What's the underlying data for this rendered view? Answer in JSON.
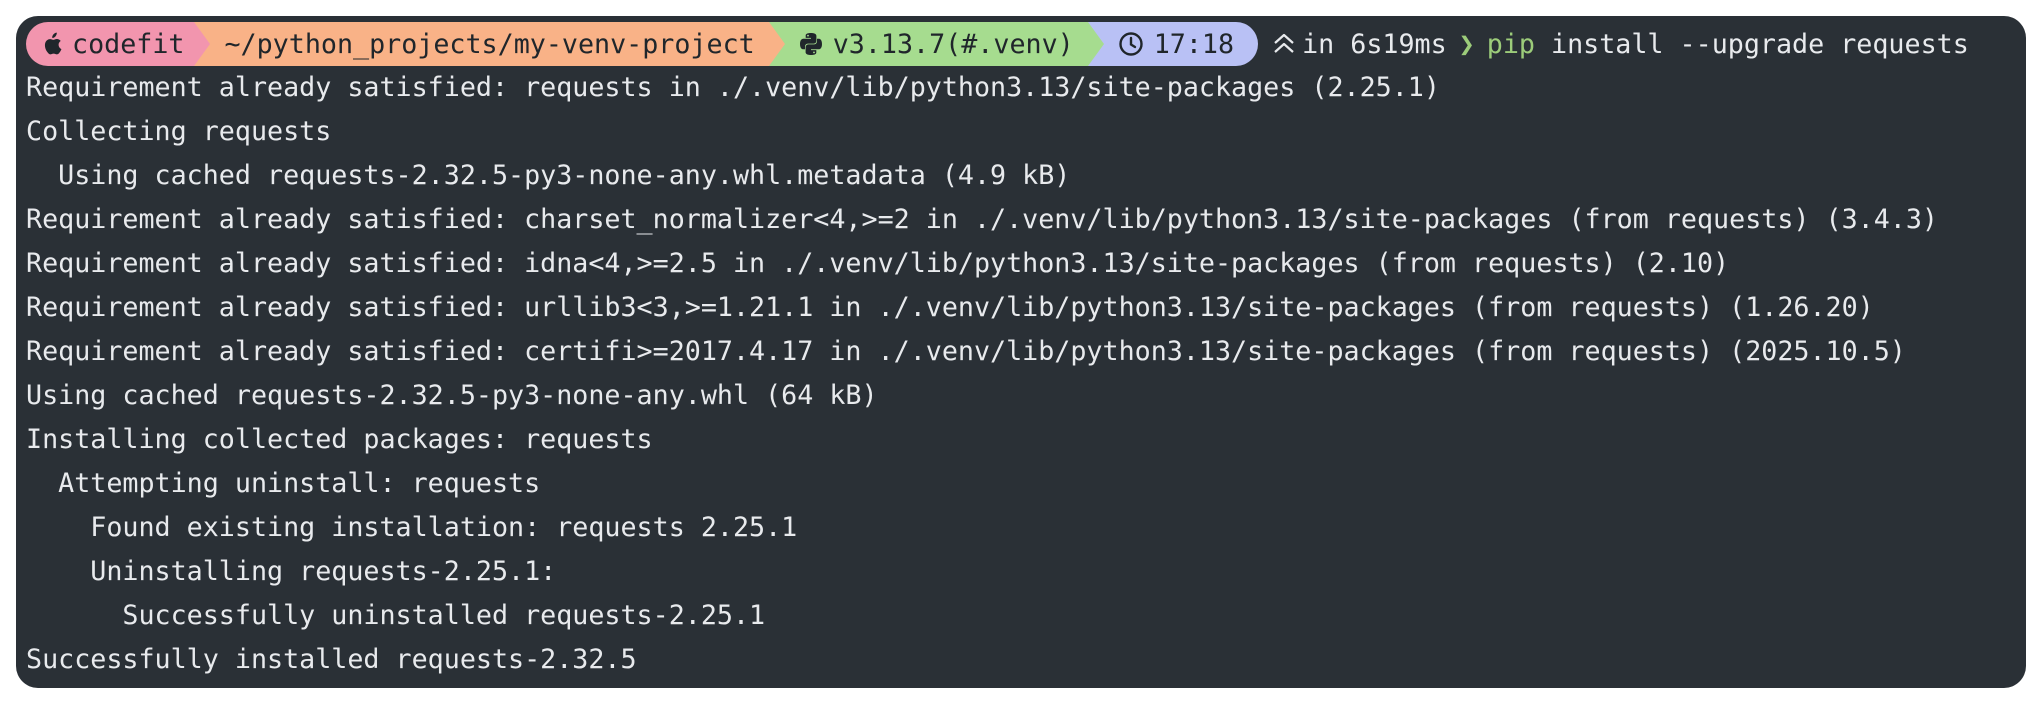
{
  "prompt": {
    "user": "codefit",
    "path": "~/python_projects/my-venv-project",
    "python": "v3.13.7(#.venv)",
    "time": "17:18",
    "duration": "in 6s19ms",
    "chevron": "❯",
    "command_head": "pip",
    "command_rest": " install --upgrade requests",
    "icons": {
      "os": "apple-icon",
      "python": "python-icon",
      "time": "clock-icon",
      "duration": "double-chevron-up-icon"
    },
    "colors": {
      "os_segment": "#f295ae",
      "path_segment": "#f9b287",
      "python_segment": "#a6dc8f",
      "time_segment": "#b9c1f5",
      "terminal_bg": "#2a3036",
      "command_green": "#9ccc7a"
    }
  },
  "output": [
    "Requirement already satisfied: requests in ./.venv/lib/python3.13/site-packages (2.25.1)",
    "Collecting requests",
    "  Using cached requests-2.32.5-py3-none-any.whl.metadata (4.9 kB)",
    "Requirement already satisfied: charset_normalizer<4,>=2 in ./.venv/lib/python3.13/site-packages (from requests) (3.4.3)",
    "Requirement already satisfied: idna<4,>=2.5 in ./.venv/lib/python3.13/site-packages (from requests) (2.10)",
    "Requirement already satisfied: urllib3<3,>=1.21.1 in ./.venv/lib/python3.13/site-packages (from requests) (1.26.20)",
    "Requirement already satisfied: certifi>=2017.4.17 in ./.venv/lib/python3.13/site-packages (from requests) (2025.10.5)",
    "Using cached requests-2.32.5-py3-none-any.whl (64 kB)",
    "Installing collected packages: requests",
    "  Attempting uninstall: requests",
    "    Found existing installation: requests 2.25.1",
    "    Uninstalling requests-2.25.1:",
    "      Successfully uninstalled requests-2.25.1",
    "Successfully installed requests-2.32.5"
  ]
}
